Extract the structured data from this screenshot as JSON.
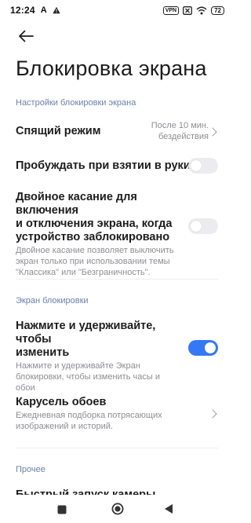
{
  "status_bar": {
    "time": "12:24",
    "vpn": "VPN",
    "battery": "72",
    "icons": [
      "text-a-icon",
      "alert-triangle-icon",
      "vpn-icon",
      "x-box-icon",
      "wifi-icon",
      "battery-icon"
    ]
  },
  "header": {
    "back_icon": "arrow-left-icon",
    "title": "Блокировка экрана"
  },
  "sections": {
    "lock_settings": {
      "header": "Настройки блокировки экрана",
      "sleep": {
        "title": "Спящий режим",
        "value_line1": "После 10 мин.",
        "value_line2": "бездействия"
      },
      "wake_on_pickup": {
        "title": "Пробуждать при взятии в руки",
        "enabled": false
      },
      "double_tap": {
        "title_line1": "Двойное касание для включения",
        "title_line2": "и отключения экрана, когда",
        "title_line3": "устройство заблокировано",
        "desc_line1": "Двойное касание позволяет выключить",
        "desc_line2": "экран только при использовании темы",
        "desc_line3": "\"Классика\" или \"Безграничность\".",
        "enabled": false
      }
    },
    "lock_screen": {
      "header": "Экран блокировки",
      "hold_to_edit": {
        "title_line1": "Нажмите и удерживайте, чтобы",
        "title_line2": "изменить",
        "desc_line1": "Нажмите и удерживайте Экран",
        "desc_line2": "блокировки, чтобы изменить часы и",
        "desc_line3": "обои",
        "enabled": true
      },
      "wallpaper_carousel": {
        "title": "Карусель обоев",
        "desc_line1": "Ежедневная подборка потрясающих",
        "desc_line2": "изображений и историй."
      }
    },
    "other": {
      "header": "Прочее",
      "partial_item": "Быстрый запуск камеры"
    }
  },
  "colors": {
    "accent": "#3478f6",
    "section_header": "#6a80ad",
    "secondary_text": "#8e8e93"
  },
  "nav_bar": {
    "icons": [
      "square-recents-icon",
      "circle-home-icon",
      "triangle-back-icon"
    ]
  }
}
